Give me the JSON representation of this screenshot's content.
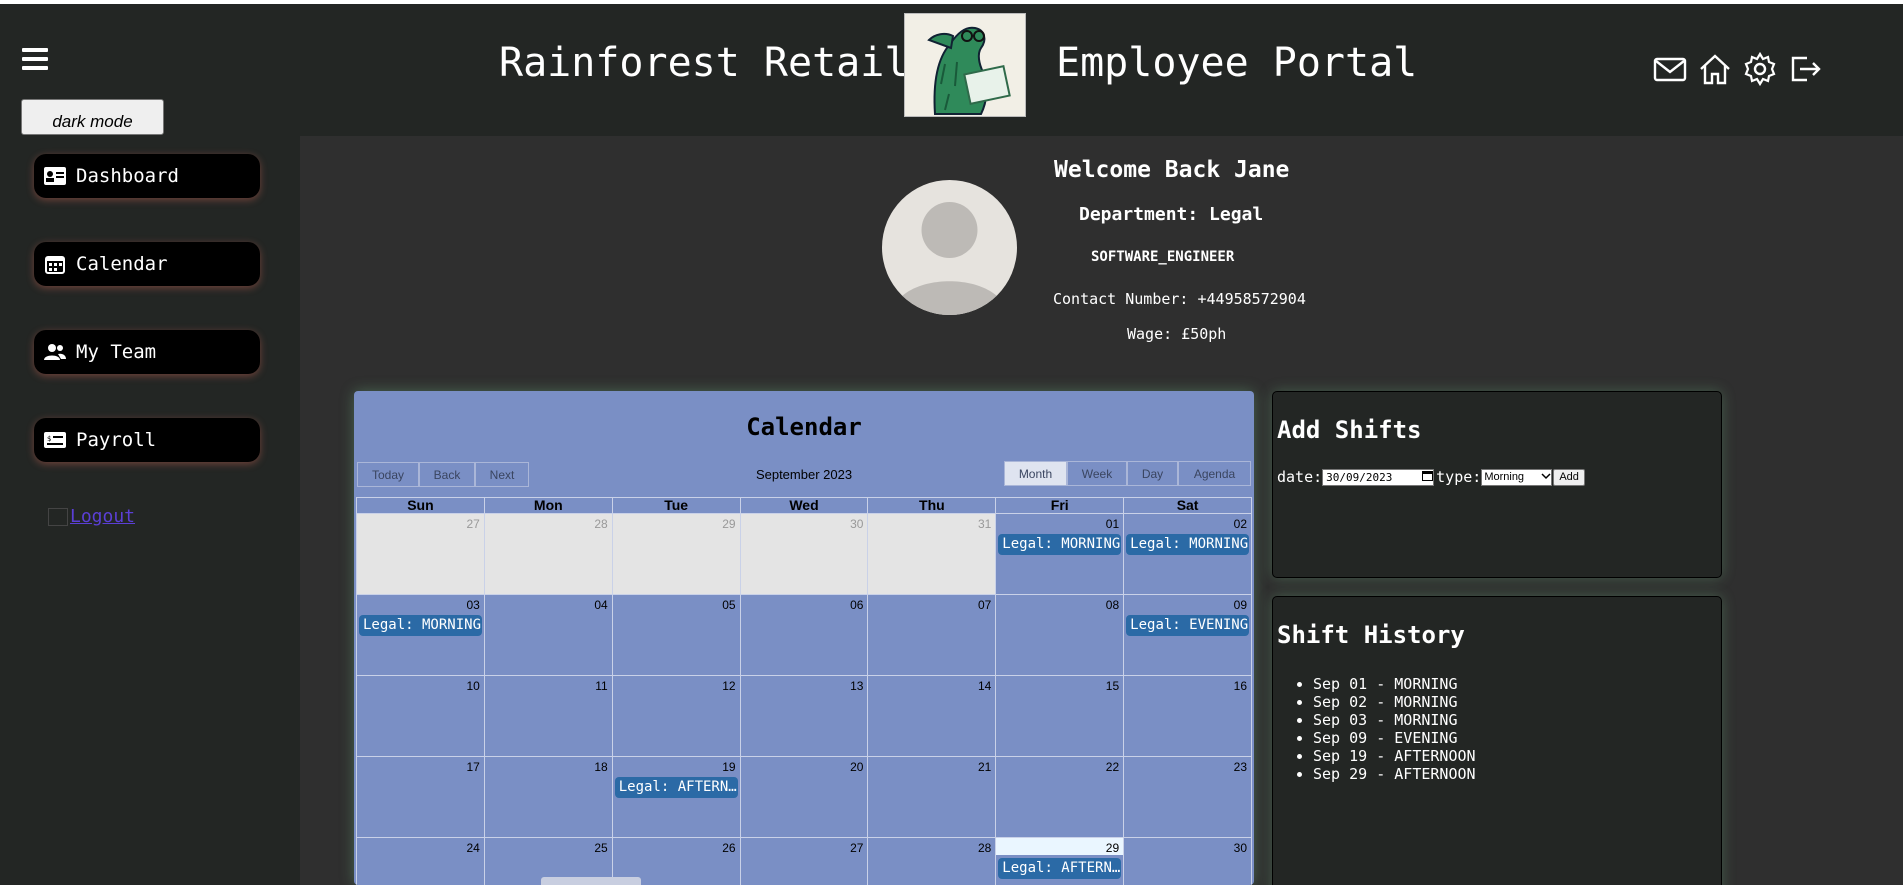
{
  "header": {
    "brand_left": "Rainforest Retail",
    "brand_right": "Employee Portal",
    "dark_mode_label": "dark mode",
    "icons": [
      "mail-icon",
      "home-icon",
      "settings-icon",
      "logout-icon"
    ]
  },
  "sidebar": {
    "items": [
      {
        "label": "Dashboard",
        "icon": "id-card-icon"
      },
      {
        "label": "Calendar",
        "icon": "calendar-icon"
      },
      {
        "label": "My Team",
        "icon": "team-icon"
      },
      {
        "label": "Payroll",
        "icon": "payroll-icon"
      }
    ],
    "logout_label": " Logout"
  },
  "profile": {
    "welcome": "Welcome Back Jane",
    "department": "Department: Legal",
    "role": "SOFTWARE_ENGINEER",
    "contact": "Contact Number: +44958572904",
    "wage": "Wage: £50ph"
  },
  "calendar": {
    "title": "Calendar",
    "nav_buttons": [
      "Today",
      "Back",
      "Next"
    ],
    "month_label": "September 2023",
    "view_buttons": [
      "Month",
      "Week",
      "Day",
      "Agenda"
    ],
    "active_view": "Month",
    "days_of_week": [
      "Sun",
      "Mon",
      "Tue",
      "Wed",
      "Thu",
      "Fri",
      "Sat"
    ],
    "weeks": [
      [
        {
          "n": "27",
          "off": true
        },
        {
          "n": "28",
          "off": true
        },
        {
          "n": "29",
          "off": true
        },
        {
          "n": "30",
          "off": true
        },
        {
          "n": "31",
          "off": true
        },
        {
          "n": "01",
          "event": "Legal: MORNING"
        },
        {
          "n": "02",
          "event": "Legal: MORNING"
        }
      ],
      [
        {
          "n": "03",
          "event": "Legal: MORNING"
        },
        {
          "n": "04"
        },
        {
          "n": "05"
        },
        {
          "n": "06"
        },
        {
          "n": "07"
        },
        {
          "n": "08"
        },
        {
          "n": "09",
          "event": "Legal: EVENING"
        }
      ],
      [
        {
          "n": "10"
        },
        {
          "n": "11"
        },
        {
          "n": "12"
        },
        {
          "n": "13"
        },
        {
          "n": "14"
        },
        {
          "n": "15"
        },
        {
          "n": "16"
        }
      ],
      [
        {
          "n": "17"
        },
        {
          "n": "18"
        },
        {
          "n": "19",
          "event": "Legal: AFTERNOON"
        },
        {
          "n": "20"
        },
        {
          "n": "21"
        },
        {
          "n": "22"
        },
        {
          "n": "23"
        }
      ],
      [
        {
          "n": "24"
        },
        {
          "n": "25"
        },
        {
          "n": "26"
        },
        {
          "n": "27"
        },
        {
          "n": "28"
        },
        {
          "n": "29",
          "event": "Legal: AFTERNOON",
          "today": true
        },
        {
          "n": "30"
        }
      ]
    ],
    "colors": {
      "panel": "#7a8fc5",
      "event": "#2b6aa6",
      "off_day": "#e4e4e4",
      "today": "#eaf6ff"
    }
  },
  "add_shifts": {
    "title": "Add Shifts",
    "date_label": "date:",
    "date_value": "30/09/2023",
    "type_label": "type:",
    "type_value": "Morning",
    "add_label": "Add"
  },
  "shift_history": {
    "title": "Shift History",
    "items": [
      "Sep 01 - MORNING",
      "Sep 02 - MORNING",
      "Sep 03 - MORNING",
      "Sep 09 - EVENING",
      "Sep 19 - AFTERNOON",
      "Sep 29 - AFTERNOON"
    ]
  }
}
